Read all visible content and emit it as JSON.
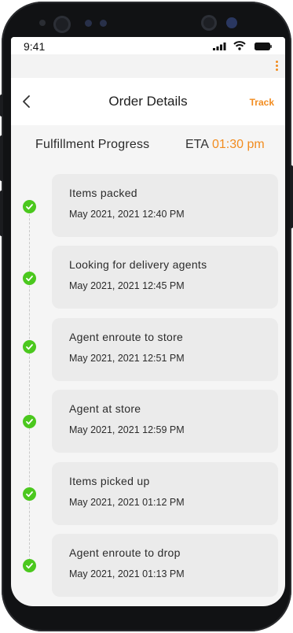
{
  "status_bar": {
    "time": "9:41"
  },
  "header": {
    "title": "Order Details",
    "track_label": "Track",
    "accent_color": "#f28c1f"
  },
  "progress": {
    "title": "Fulfillment Progress",
    "eta_label": "ETA",
    "eta_time": "01:30 pm"
  },
  "steps": [
    {
      "name": "Items packed",
      "timestamp": "May 2021, 2021 12:40 PM",
      "status": "done"
    },
    {
      "name": "Looking for delivery agents",
      "timestamp": "May 2021, 2021 12:45 PM",
      "status": "done"
    },
    {
      "name": "Agent enroute to store",
      "timestamp": "May 2021, 2021 12:51 PM",
      "status": "done"
    },
    {
      "name": "Agent at store",
      "timestamp": "May 2021, 2021 12:59 PM",
      "status": "done"
    },
    {
      "name": "Items picked up",
      "timestamp": "May 2021, 2021 01:12 PM",
      "status": "done"
    },
    {
      "name": "Agent enroute to drop",
      "timestamp": "May 2021, 2021 01:13 PM",
      "status": "done"
    }
  ],
  "icons": {
    "back": "chevron-left-icon",
    "menu": "kebab-menu-icon",
    "step_done": "check-circle-icon"
  },
  "colors": {
    "done": "#4bc81e",
    "card_bg": "#ebebeb"
  }
}
